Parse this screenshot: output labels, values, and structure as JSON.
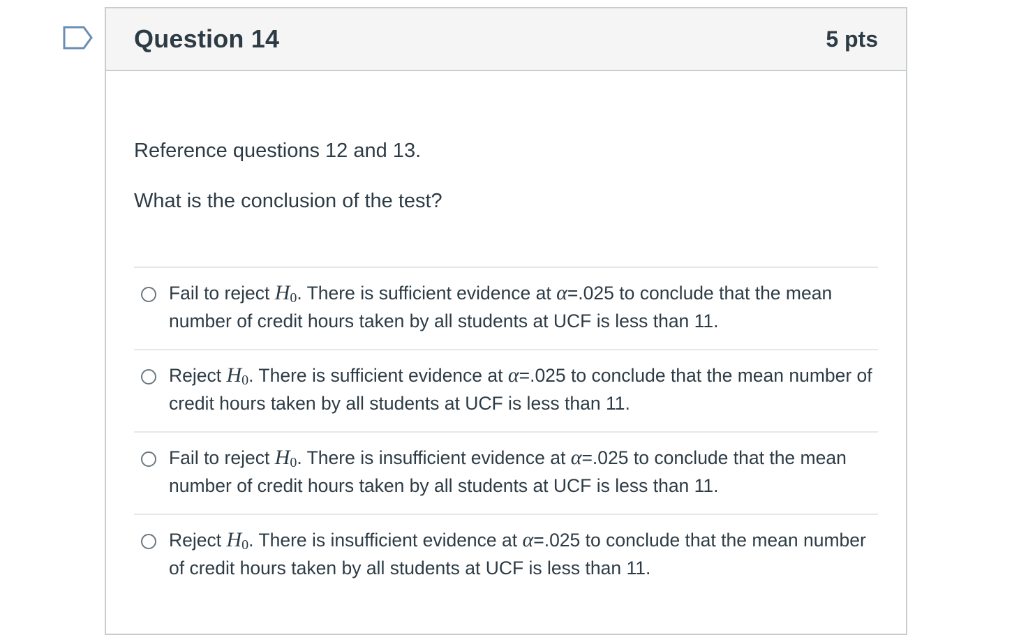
{
  "question": {
    "title": "Question 14",
    "points": "5 pts",
    "flag_icon": "bookmark-flag-icon",
    "text_1": "Reference questions 12 and 13.",
    "text_2": "What is the conclusion of the test?"
  },
  "math": {
    "h_symbol": "H",
    "h_sub": "0",
    "alpha": "α"
  },
  "answers": [
    {
      "prefix": "Fail to reject ",
      "mid": ". There is sufficient evidence at ",
      "suffix": "=.025 to conclude that the mean number of credit hours taken by all students at UCF is less than 11."
    },
    {
      "prefix": "Reject ",
      "mid": ". There is sufficient evidence at ",
      "suffix": "=.025 to conclude that the mean number of credit hours taken by all students at UCF is less than 11."
    },
    {
      "prefix": "Fail to reject ",
      "mid": ". There is insufficient evidence at ",
      "suffix": "=.025 to conclude that the mean number of credit hours taken by all students at UCF is less than 11."
    },
    {
      "prefix": "Reject ",
      "mid": ". There is insufficient evidence at ",
      "suffix": "=.025 to conclude that the mean number of credit hours taken by all students at UCF is less than 11."
    }
  ],
  "colors": {
    "text": "#2d3b45",
    "header_bg": "#f5f5f5",
    "border": "#c7cdd1",
    "divider": "#e5e8ea",
    "flag_stroke": "#6a8fb4"
  }
}
